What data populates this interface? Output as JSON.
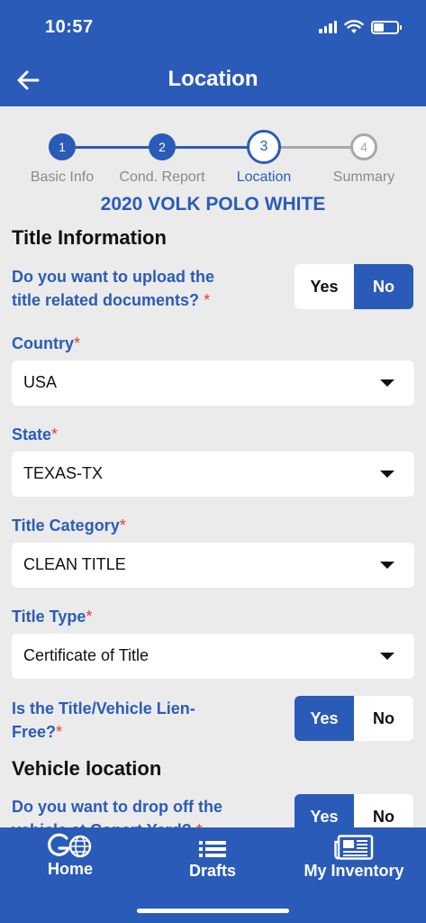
{
  "status_bar": {
    "time": "10:57"
  },
  "header": {
    "title": "Location"
  },
  "stepper": {
    "steps": [
      {
        "number": "1",
        "label": "Basic Info"
      },
      {
        "number": "2",
        "label": "Cond. Report"
      },
      {
        "number": "3",
        "label": "Location"
      },
      {
        "number": "4",
        "label": "Summary"
      }
    ]
  },
  "vehicle": {
    "name": "2020 VOLK POLO WHITE"
  },
  "title_information": {
    "heading": "Title Information",
    "upload_question": "Do you want to upload the title related documents?",
    "upload_yes": "Yes",
    "upload_no": "No",
    "country_label": "Country",
    "country_value": "USA",
    "state_label": "State",
    "state_value": "TEXAS-TX",
    "category_label": "Title Category",
    "category_value": "CLEAN TITLE",
    "type_label": "Title Type",
    "type_value": "Certificate of Title",
    "lien_question": "Is the Title/Vehicle Lien-Free?",
    "lien_yes": "Yes",
    "lien_no": "No"
  },
  "vehicle_location": {
    "heading": "Vehicle location",
    "dropoff_question": "Do you want to drop off the vehicle at Copart Yard?",
    "dropoff_yes": "Yes",
    "dropoff_no": "No"
  },
  "required_marker": "*",
  "tab_bar": {
    "home": "Home",
    "drafts": "Drafts",
    "inventory": "My Inventory"
  },
  "colors": {
    "primary": "#2b5bb8",
    "background": "#ebebeb",
    "required": "#e53935"
  }
}
